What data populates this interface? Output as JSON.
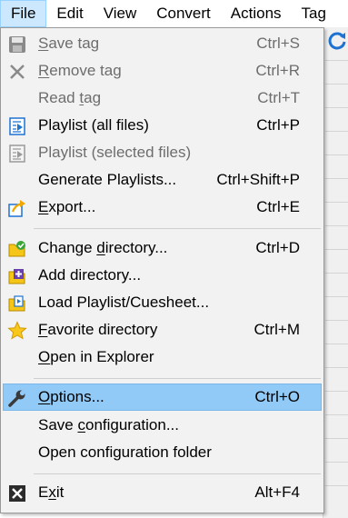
{
  "menubar": {
    "items": [
      "File",
      "Edit",
      "View",
      "Convert",
      "Actions",
      "Tag"
    ]
  },
  "menu": {
    "items": [
      {
        "pre": "",
        "ul": "S",
        "post": "ave tag",
        "shortcut": "Ctrl+S",
        "icon": "save-icon",
        "enabled": false
      },
      {
        "pre": "",
        "ul": "R",
        "post": "emove tag",
        "shortcut": "Ctrl+R",
        "icon": "remove-icon",
        "enabled": false
      },
      {
        "pre": "Read ",
        "ul": "t",
        "post": "ag",
        "shortcut": "Ctrl+T",
        "icon": "",
        "enabled": false
      },
      {
        "pre": "Playlist (all files)",
        "ul": "",
        "post": "",
        "shortcut": "Ctrl+P",
        "icon": "playlist-icon",
        "enabled": true
      },
      {
        "pre": "Playlist (selected files)",
        "ul": "",
        "post": "",
        "shortcut": "",
        "icon": "playlist-selected-icon",
        "enabled": false
      },
      {
        "pre": "Generate Playlists...",
        "ul": "",
        "post": "",
        "shortcut": "Ctrl+Shift+P",
        "icon": "",
        "enabled": true
      },
      {
        "pre": "",
        "ul": "E",
        "post": "xport...",
        "shortcut": "Ctrl+E",
        "icon": "export-icon",
        "enabled": true
      },
      {
        "pre": "Change ",
        "ul": "d",
        "post": "irectory...",
        "shortcut": "Ctrl+D",
        "icon": "change-directory-icon",
        "enabled": true
      },
      {
        "pre": "Add directory...",
        "ul": "",
        "post": "",
        "shortcut": "",
        "icon": "add-directory-icon",
        "enabled": true
      },
      {
        "pre": "Load Playlist/Cuesheet...",
        "ul": "",
        "post": "",
        "shortcut": "",
        "icon": "load-playlist-icon",
        "enabled": true
      },
      {
        "pre": "",
        "ul": "F",
        "post": "avorite directory",
        "shortcut": "Ctrl+M",
        "icon": "star-icon",
        "enabled": true
      },
      {
        "pre": "",
        "ul": "O",
        "post": "pen in Explorer",
        "shortcut": "",
        "icon": "",
        "enabled": true
      },
      {
        "pre": "",
        "ul": "O",
        "post": "ptions...",
        "shortcut": "Ctrl+O",
        "icon": "wrench-icon",
        "enabled": true,
        "highlighted": true
      },
      {
        "pre": "Save ",
        "ul": "c",
        "post": "onfiguration...",
        "shortcut": "",
        "icon": "",
        "enabled": true
      },
      {
        "pre": "Open configuration folder",
        "ul": "",
        "post": "",
        "shortcut": "",
        "icon": "",
        "enabled": true
      },
      {
        "pre": "E",
        "ul": "x",
        "post": "it",
        "shortcut": "Alt+F4",
        "icon": "exit-icon",
        "enabled": true
      }
    ]
  },
  "colors": {
    "highlight": "#91c9f7",
    "menu_background": "#f2f2f2",
    "disabled_text": "#6d6d6d",
    "folder_yellow": "#f5c518",
    "accent_blue": "#1e73d2"
  }
}
